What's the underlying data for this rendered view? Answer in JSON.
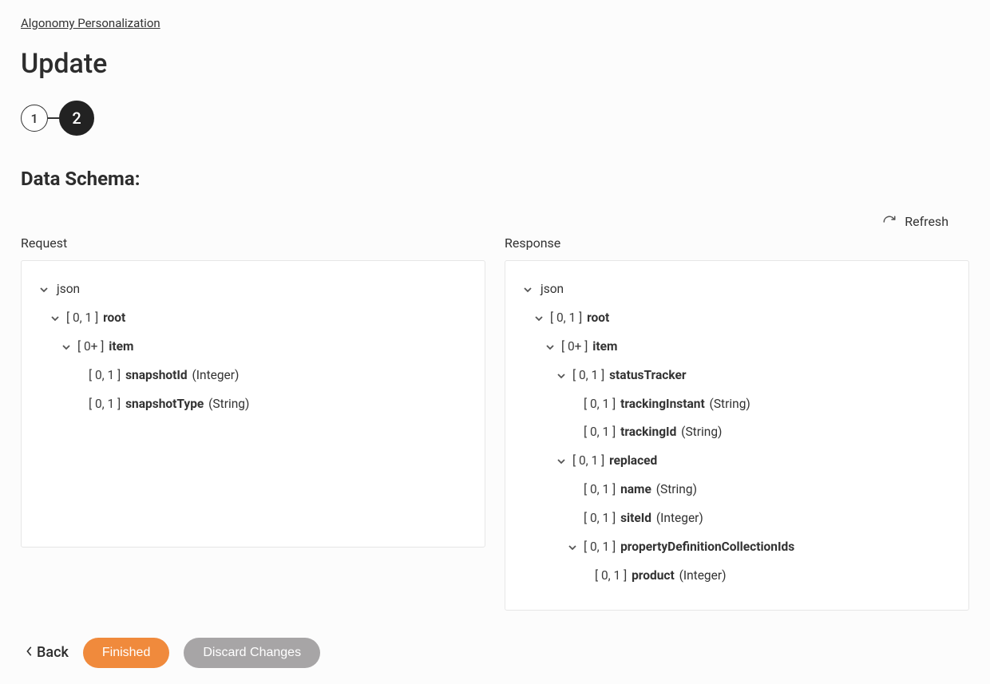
{
  "breadcrumb": "Algonomy Personalization",
  "page_title": "Update",
  "stepper": {
    "steps": [
      "1",
      "2"
    ],
    "active_index": 1
  },
  "section_title": "Data Schema:",
  "refresh_label": "Refresh",
  "request_label": "Request",
  "response_label": "Response",
  "request_tree": [
    {
      "indent": 0,
      "expandable": true,
      "cardinality": "",
      "name": "json",
      "dtype": "",
      "bold": false
    },
    {
      "indent": 1,
      "expandable": true,
      "cardinality": "[ 0, 1 ]",
      "name": "root",
      "dtype": "",
      "bold": true
    },
    {
      "indent": 2,
      "expandable": true,
      "cardinality": "[ 0+ ]",
      "name": "item",
      "dtype": "",
      "bold": true
    },
    {
      "indent": 3,
      "expandable": false,
      "cardinality": "[ 0, 1 ]",
      "name": "snapshotId",
      "dtype": "(Integer)",
      "bold": true
    },
    {
      "indent": 3,
      "expandable": false,
      "cardinality": "[ 0, 1 ]",
      "name": "snapshotType",
      "dtype": "(String)",
      "bold": true
    }
  ],
  "response_tree": [
    {
      "indent": 0,
      "expandable": true,
      "cardinality": "",
      "name": "json",
      "dtype": "",
      "bold": false
    },
    {
      "indent": 1,
      "expandable": true,
      "cardinality": "[ 0, 1 ]",
      "name": "root",
      "dtype": "",
      "bold": true
    },
    {
      "indent": 2,
      "expandable": true,
      "cardinality": "[ 0+ ]",
      "name": "item",
      "dtype": "",
      "bold": true
    },
    {
      "indent": 3,
      "expandable": true,
      "cardinality": "[ 0, 1 ]",
      "name": "statusTracker",
      "dtype": "",
      "bold": true
    },
    {
      "indent": 4,
      "expandable": false,
      "cardinality": "[ 0, 1 ]",
      "name": "trackingInstant",
      "dtype": "(String)",
      "bold": true
    },
    {
      "indent": 4,
      "expandable": false,
      "cardinality": "[ 0, 1 ]",
      "name": "trackingId",
      "dtype": "(String)",
      "bold": true
    },
    {
      "indent": 3,
      "expandable": true,
      "cardinality": "[ 0, 1 ]",
      "name": "replaced",
      "dtype": "",
      "bold": true
    },
    {
      "indent": 4,
      "expandable": false,
      "cardinality": "[ 0, 1 ]",
      "name": "name",
      "dtype": "(String)",
      "bold": true
    },
    {
      "indent": 4,
      "expandable": false,
      "cardinality": "[ 0, 1 ]",
      "name": "siteId",
      "dtype": "(Integer)",
      "bold": true
    },
    {
      "indent": 4,
      "expandable": true,
      "cardinality": "[ 0, 1 ]",
      "name": "propertyDefinitionCollectionIds",
      "dtype": "",
      "bold": true
    },
    {
      "indent": 5,
      "expandable": false,
      "cardinality": "[ 0, 1 ]",
      "name": "product",
      "dtype": "(Integer)",
      "bold": true
    }
  ],
  "footer": {
    "back": "Back",
    "finished": "Finished",
    "discard": "Discard Changes"
  }
}
